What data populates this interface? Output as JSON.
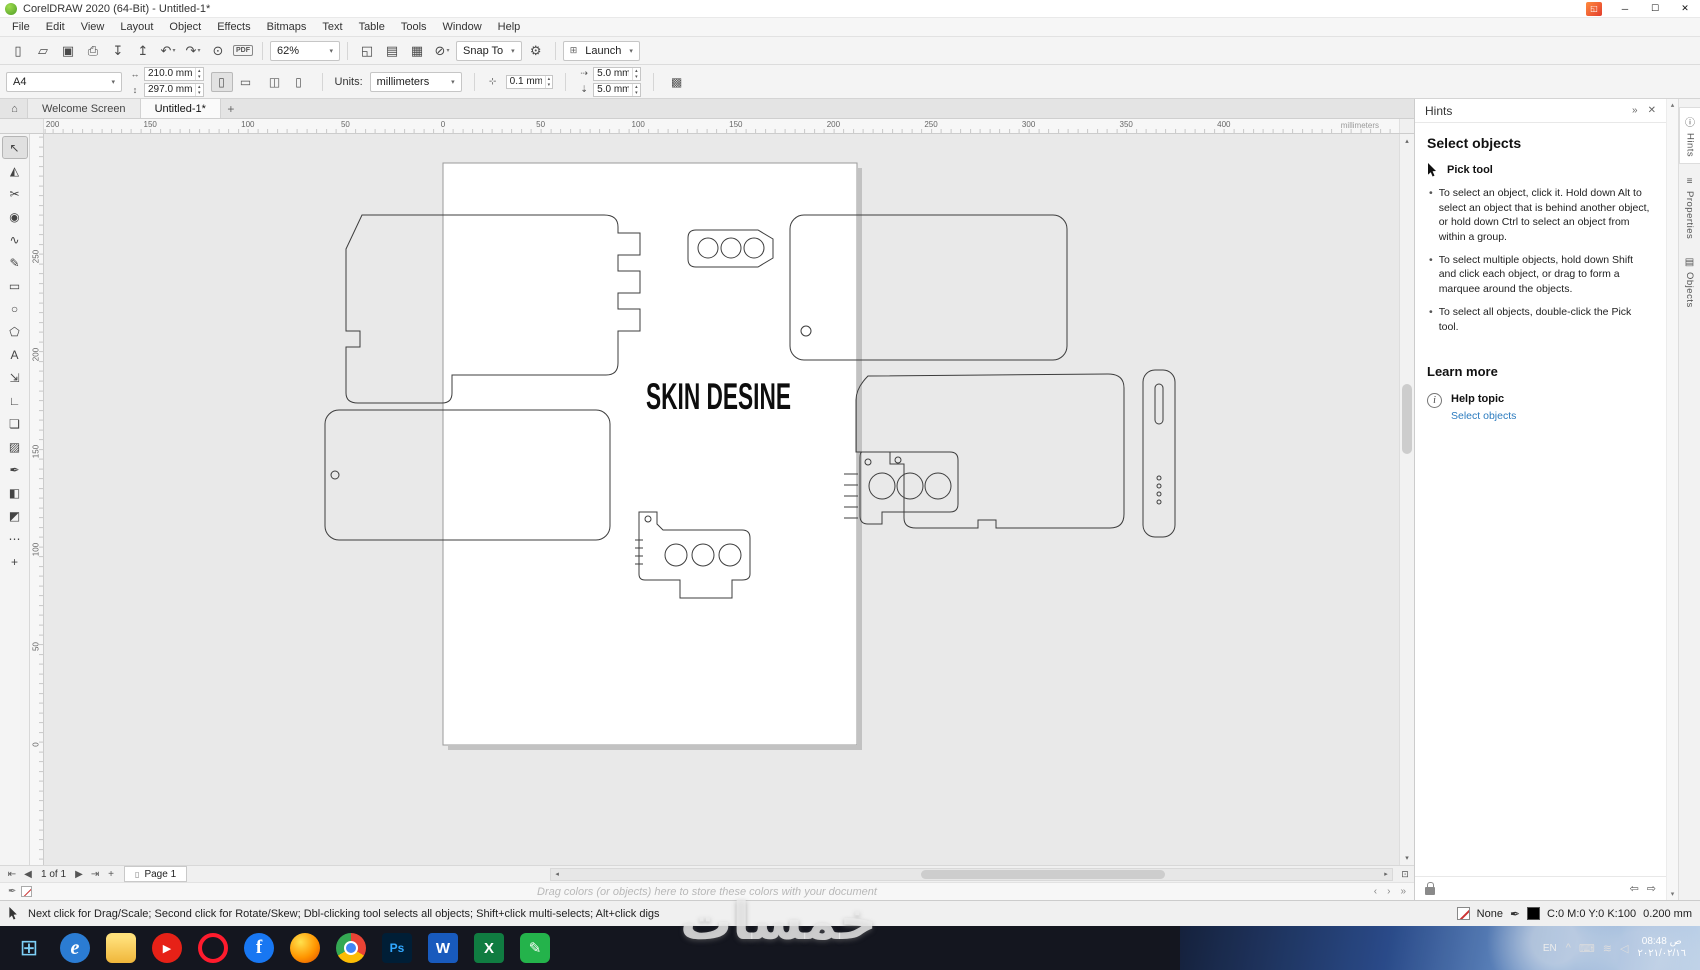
{
  "titlebar": {
    "title": "CorelDRAW 2020 (64-Bit) - Untitled-1*",
    "window_buttons": {
      "minimize": "─",
      "maximize": "☐",
      "close": "✕"
    }
  },
  "menubar": {
    "items": [
      "File",
      "Edit",
      "View",
      "Layout",
      "Object",
      "Effects",
      "Bitmaps",
      "Text",
      "Table",
      "Tools",
      "Window",
      "Help"
    ]
  },
  "std_toolbar": {
    "left_icons": [
      {
        "name": "new-document",
        "glyph": "▯"
      },
      {
        "name": "open",
        "glyph": "▱"
      },
      {
        "name": "save",
        "glyph": "▣"
      },
      {
        "name": "print",
        "glyph": "⎙"
      },
      {
        "name": "import",
        "glyph": "↧"
      },
      {
        "name": "export",
        "glyph": "↥"
      },
      {
        "name": "undo",
        "glyph": "↶",
        "dd": true
      },
      {
        "name": "redo",
        "glyph": "↷",
        "dd": true
      },
      {
        "name": "search-content",
        "glyph": "⊙"
      },
      {
        "name": "publish-pdf",
        "glyph": "PDF",
        "text": true
      }
    ],
    "zoom_value": "62%",
    "view_icons": [
      {
        "name": "fullscreen-preview",
        "glyph": "◱"
      },
      {
        "name": "show-rulers",
        "glyph": "▤"
      },
      {
        "name": "show-grid",
        "glyph": "▦"
      },
      {
        "name": "snap-off",
        "glyph": "⊘",
        "dd": true
      }
    ],
    "snap_label": "Snap To",
    "launch_label": "Launch"
  },
  "propbar": {
    "page_size": "A4",
    "page_width": "210.0 mm",
    "page_height": "297.0 mm",
    "orientation_icons": [
      {
        "name": "portrait",
        "glyph": "▯",
        "active": true
      },
      {
        "name": "landscape",
        "glyph": "▭"
      }
    ],
    "page_mode_icons": [
      {
        "name": "all-pages",
        "glyph": "◫"
      },
      {
        "name": "current-page",
        "glyph": "▯"
      }
    ],
    "units_label": "Units:",
    "units_value": "millimeters",
    "nudge_value": "0.1 mm",
    "dup_x": "5.0 mm",
    "dup_y": "5.0 mm"
  },
  "doctabs": {
    "home_glyph": "⌂",
    "tabs": [
      {
        "label": "Welcome Screen"
      },
      {
        "label": "Untitled-1*"
      }
    ]
  },
  "ruler": {
    "h_ticks": [
      "200",
      "150",
      "100",
      "50",
      "0",
      "50",
      "100",
      "150",
      "200",
      "250",
      "300",
      "350",
      "400"
    ],
    "v_ticks": [
      "250",
      "200",
      "150",
      "100",
      "50",
      "0"
    ],
    "units": "millimeters"
  },
  "toolbox": {
    "tools": [
      {
        "name": "pick-tool",
        "glyph": "↖",
        "active": true
      },
      {
        "name": "shape-tool",
        "glyph": "◭"
      },
      {
        "name": "crop-tool",
        "glyph": "✂"
      },
      {
        "name": "zoom-tool",
        "glyph": "◉"
      },
      {
        "name": "freehand-tool",
        "glyph": "∿"
      },
      {
        "name": "artistic-media-tool",
        "glyph": "✎"
      },
      {
        "name": "rectangle-tool",
        "glyph": "▭"
      },
      {
        "name": "ellipse-tool",
        "glyph": "○"
      },
      {
        "name": "polygon-tool",
        "glyph": "⬠"
      },
      {
        "name": "text-tool",
        "glyph": "A"
      },
      {
        "name": "dimension-tool",
        "glyph": "⇲"
      },
      {
        "name": "connector-tool",
        "glyph": "∟"
      },
      {
        "name": "drop-shadow-tool",
        "glyph": "❏"
      },
      {
        "name": "transparency-tool",
        "glyph": "▨"
      },
      {
        "name": "eyedropper-tool",
        "glyph": "✒"
      },
      {
        "name": "interactive-fill-tool",
        "glyph": "◧"
      },
      {
        "name": "smart-fill-tool",
        "glyph": "◩"
      },
      {
        "name": "more-tools",
        "glyph": "⋯"
      },
      {
        "name": "customize-toolbox",
        "glyph": "+"
      }
    ]
  },
  "canvas": {
    "drawing_text": "SKIN DESINE"
  },
  "hints": {
    "title": "Hints",
    "heading": "Select objects",
    "tool_label": "Pick tool",
    "bullets": [
      "To select an object, click it. Hold down Alt to select an object that is behind another object, or hold down Ctrl to select an object from within a group.",
      "To select multiple objects, hold down Shift and click each object, or drag to form a marquee around the objects.",
      "To select all objects, double-click the Pick tool."
    ],
    "learn_more": "Learn more",
    "help_topic": "Help topic",
    "help_link": "Select objects"
  },
  "docker": {
    "tabs": [
      {
        "name": "hints",
        "label": "Hints",
        "glyph": "ⓘ",
        "active": true
      },
      {
        "name": "properties",
        "label": "Properties",
        "glyph": "≡"
      },
      {
        "name": "objects",
        "label": "Objects",
        "glyph": "▤"
      }
    ]
  },
  "pagenav": {
    "position": "1 of 1",
    "page_tab": "Page 1",
    "icons": {
      "first": "⇤",
      "prev": "◀",
      "next": "▶",
      "last": "⇥",
      "add": "+"
    }
  },
  "palette_row": {
    "hint": "Drag colors (or objects) here to store these colors with your document"
  },
  "statusbar": {
    "message": "Next click for Drag/Scale; Second click for Rotate/Skew; Dbl-clicking tool selects all objects; Shift+click multi-selects; Alt+click digs",
    "fill_label": "None",
    "outline_color": "C:0 M:0 Y:0 K:100",
    "outline_width": "0.200 mm"
  },
  "watermark": {
    "text": "خمسات"
  },
  "taskbar": {
    "icons": [
      {
        "name": "start",
        "glyph": "⊞",
        "fg": "#7ed0f7"
      },
      {
        "name": "edge",
        "glyph": "e",
        "fg": "#ffffff",
        "bg": "#2b7cd3",
        "round": true
      },
      {
        "name": "file-explorer",
        "glyph": "",
        "fg": "#7a5d10"
      },
      {
        "name": "youtube",
        "glyph": "▶",
        "fg": "#ffffff",
        "bg": "#e62117",
        "round": true
      },
      {
        "name": "opera",
        "glyph": "",
        "fg": "#ff1b2d",
        "round": true
      },
      {
        "name": "facebook",
        "glyph": "f",
        "fg": "#ffffff",
        "bg": "#1877f2",
        "round": true
      },
      {
        "name": "firefox",
        "glyph": "",
        "fg": "#ffffff",
        "round": true
      },
      {
        "name": "chrome",
        "glyph": "",
        "fg": "#ffffff",
        "round": true
      },
      {
        "name": "photoshop",
        "glyph": "Ps",
        "fg": "#31a8ff",
        "bg": "#001e36"
      },
      {
        "name": "word",
        "glyph": "W",
        "fg": "#ffffff",
        "bg": "#185abd"
      },
      {
        "name": "excel",
        "glyph": "X",
        "fg": "#ffffff",
        "bg": "#107c41"
      },
      {
        "name": "green-app",
        "glyph": "✎",
        "fg": "#ffffff",
        "bg": "#24b34b"
      }
    ],
    "tray": {
      "lang": "EN",
      "items": [
        {
          "name": "tray-expand",
          "glyph": "^"
        },
        {
          "name": "touch-keyboard",
          "glyph": "⌨"
        },
        {
          "name": "network",
          "glyph": "≋"
        },
        {
          "name": "volume",
          "glyph": "◁"
        }
      ],
      "time": "08:48 ص",
      "date": "٢٠٢١/٠٢/١٦"
    }
  },
  "colors": {
    "accent_link": "#2b7bbf",
    "outline_stroke": "#3d3d3d",
    "taskbar_bg": "#14161f"
  }
}
